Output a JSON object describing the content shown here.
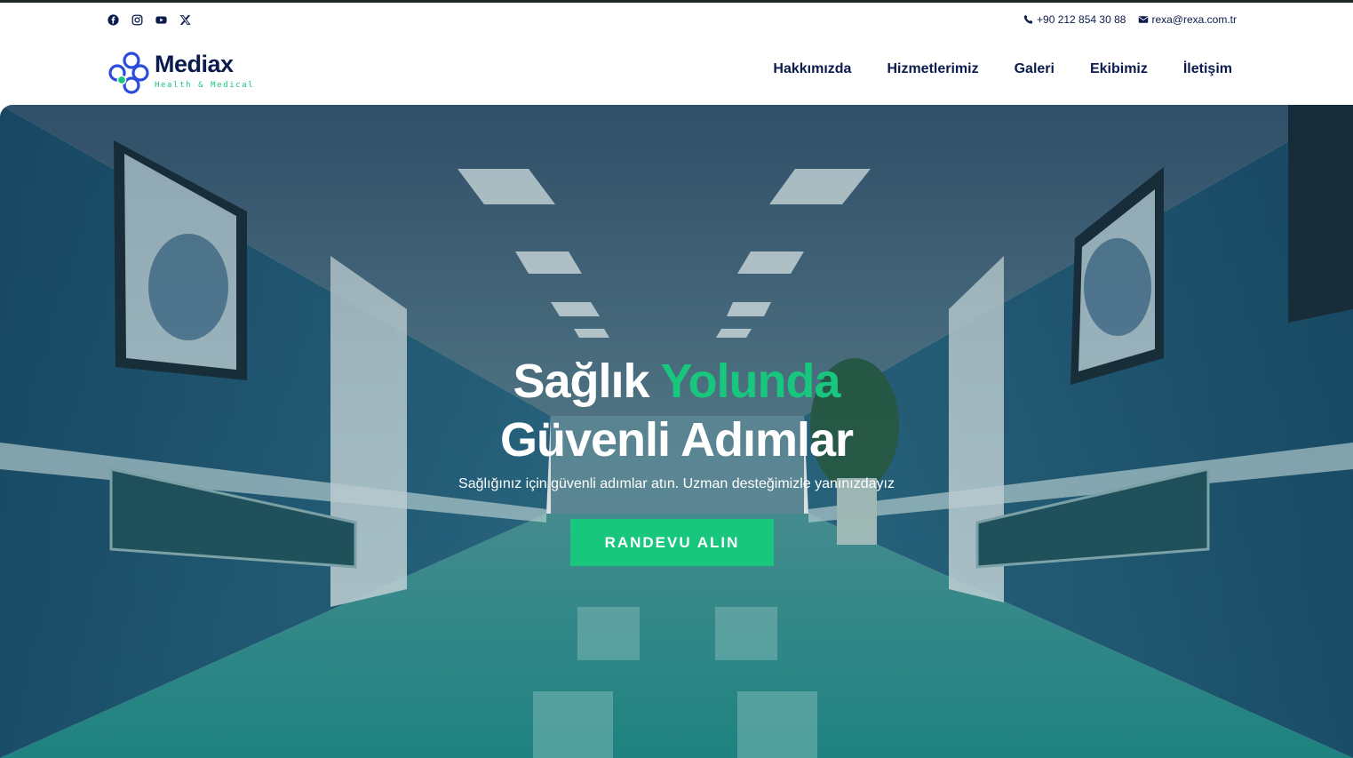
{
  "topbar": {
    "social": [
      {
        "icon": "facebook-icon"
      },
      {
        "icon": "instagram-icon"
      },
      {
        "icon": "youtube-icon"
      },
      {
        "icon": "x-twitter-icon"
      }
    ],
    "phone": "+90 212 854 30 88",
    "email": "rexa@rexa.com.tr"
  },
  "logo": {
    "brand": "Mediax",
    "tagline": "Health & Medical"
  },
  "nav": {
    "items": [
      "Hakkımızda",
      "Hizmetlerimiz",
      "Galeri",
      "Ekibimiz",
      "İletişim"
    ]
  },
  "hero": {
    "title_part1": "Sağlık ",
    "title_accent": "Yolunda",
    "title_line2": "Güvenli Adımlar",
    "subtitle": "Sağlığınız için güvenli adımlar atın. Uzman desteğimizle yanınızdayız",
    "cta_label": "RANDEVU ALIN"
  },
  "colors": {
    "accent": "#19c67d",
    "navy": "#0b1b4d"
  }
}
